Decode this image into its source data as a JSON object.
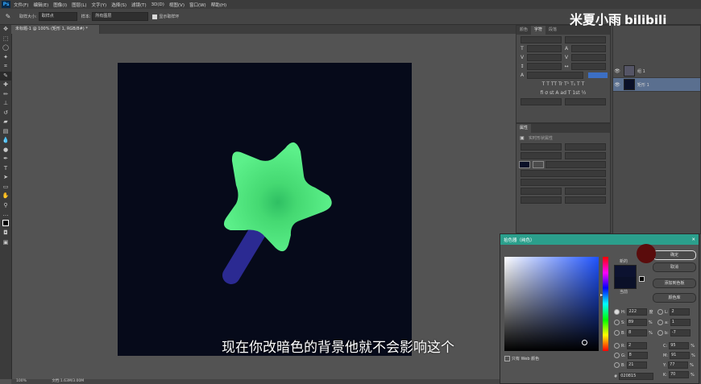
{
  "menubar": {
    "logo": "Ps",
    "items": [
      "文件(F)",
      "编辑(E)",
      "图像(I)",
      "图层(L)",
      "文字(Y)",
      "选择(S)",
      "滤镜(T)",
      "3D(D)",
      "视图(V)",
      "窗口(W)",
      "帮助(H)"
    ]
  },
  "options": {
    "sample_size_label": "取样大小:",
    "sample_size_value": "取样点",
    "sample_label": "样本:",
    "sample_value": "所有图层",
    "show_ring_label": "显示取样环"
  },
  "document": {
    "tab_title": "未标题-1 @ 100% (矩形 1, RGB/8#) *",
    "zoom": "100%",
    "doc_info": "文档:1.63M/3.00M"
  },
  "char_panel": {
    "tabs": [
      "颜色",
      "字符",
      "段落"
    ],
    "active_tab": 1
  },
  "props_panel": {
    "title": "属性",
    "subtitle": "实时形状属性"
  },
  "layers": {
    "items": [
      {
        "name": "组 1",
        "selected": false
      },
      {
        "name": "矩形 1",
        "selected": true
      }
    ]
  },
  "picker": {
    "title": "拾色器（纯色）",
    "new_label": "新的",
    "current_label": "当前",
    "buttons": {
      "ok": "确定",
      "cancel": "取消",
      "add_swatch": "添加到色板",
      "libraries": "颜色库"
    },
    "web_only": "只有 Web 颜色",
    "hex_label": "#",
    "hex_value": "020815",
    "hsb": [
      {
        "label": "H:",
        "value": "222",
        "unit": "度"
      },
      {
        "label": "S:",
        "value": "89",
        "unit": "%"
      },
      {
        "label": "B:",
        "value": "8",
        "unit": "%"
      }
    ],
    "rgb": [
      {
        "label": "R:",
        "value": "2"
      },
      {
        "label": "G:",
        "value": "8"
      },
      {
        "label": "B:",
        "value": "21"
      }
    ],
    "lab": [
      {
        "label": "L:",
        "value": "2"
      },
      {
        "label": "a:",
        "value": "1"
      },
      {
        "label": "b:",
        "value": "-7"
      }
    ],
    "cmyk": [
      {
        "label": "C:",
        "value": "95",
        "unit": "%"
      },
      {
        "label": "M:",
        "value": "91",
        "unit": "%"
      },
      {
        "label": "Y:",
        "value": "77",
        "unit": "%"
      },
      {
        "label": "K:",
        "value": "70",
        "unit": "%"
      }
    ],
    "new_color": "#0c1230",
    "current_color": "#0a1028"
  },
  "watermark": {
    "name": "米夏小雨",
    "brand": "bilibili"
  },
  "subtitle": "现在你改暗色的背景他就不会影响这个",
  "colors": {
    "canvas_bg": "#060a1a",
    "star": "#54ec84",
    "star_glow": "#2fbf63",
    "handle": "#2b2a92",
    "dialog_title": "#2b9f8c"
  }
}
